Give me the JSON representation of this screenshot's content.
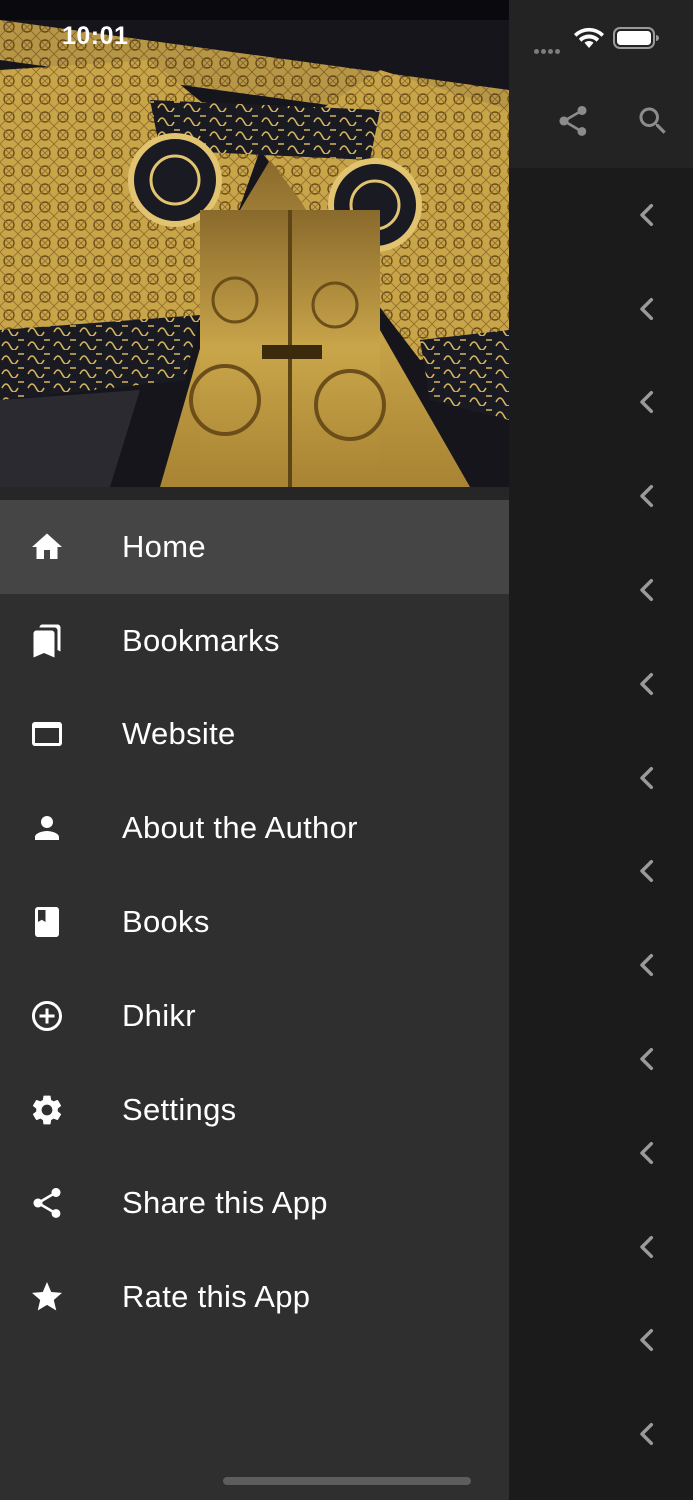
{
  "status_bar": {
    "time": "10:01"
  },
  "drawer": {
    "header_image_name": "kaaba-door-photo",
    "menu": [
      {
        "label": "Home",
        "icon": "home-icon",
        "active": true
      },
      {
        "label": "Bookmarks",
        "icon": "bookmarks-icon",
        "active": false
      },
      {
        "label": "Website",
        "icon": "web-window-icon",
        "active": false
      },
      {
        "label": "About the Author",
        "icon": "person-icon",
        "active": false
      },
      {
        "label": "Books",
        "icon": "book-icon",
        "active": false
      },
      {
        "label": "Dhikr",
        "icon": "add-circle-icon",
        "active": false
      },
      {
        "label": "Settings",
        "icon": "gear-icon",
        "active": false
      },
      {
        "label": "Share this App",
        "icon": "share-icon",
        "active": false
      },
      {
        "label": "Rate this App",
        "icon": "star-icon",
        "active": false
      }
    ]
  },
  "background_app": {
    "toolbar_actions": [
      "share-icon",
      "search-icon"
    ],
    "list_row_icon": "chevron-left-icon"
  },
  "colors": {
    "drawer_bg": "#2f2f30",
    "active_item_bg": "#454546",
    "page_bg": "#1b1b1b",
    "appbar_bg": "#232323",
    "gold": "#c9a54a"
  }
}
